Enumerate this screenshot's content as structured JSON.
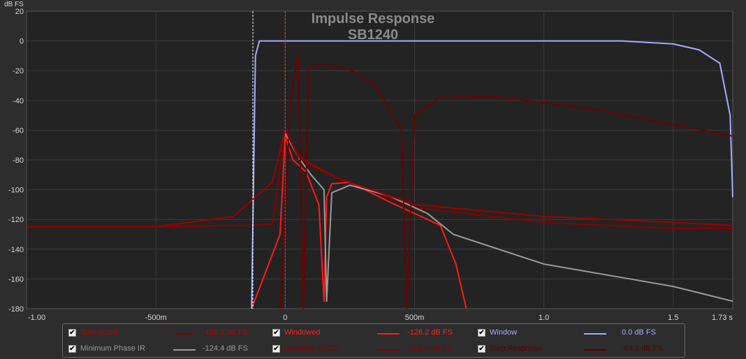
{
  "chart_data": {
    "type": "line",
    "title": "Impulse Response",
    "subtitle": "SB1240",
    "ylabel": "dB FS",
    "xunit": "s",
    "xlim": [
      -1.0,
      1.73
    ],
    "ylim": [
      -180,
      20
    ],
    "grid": true,
    "x_ticks": [
      {
        "value": -1.0,
        "label": "-1.00"
      },
      {
        "value": -0.5,
        "label": "-500m"
      },
      {
        "value": 0.0,
        "label": "0"
      },
      {
        "value": 0.5,
        "label": "500m"
      },
      {
        "value": 1.0,
        "label": "1.0"
      },
      {
        "value": 1.5,
        "label": "1.5"
      },
      {
        "value": 1.73,
        "label": "1.73 s"
      }
    ],
    "y_ticks": [
      20,
      0,
      -20,
      -40,
      -60,
      -80,
      -100,
      -120,
      -140,
      -160,
      -180
    ],
    "markers": [
      {
        "x": -0.125,
        "color": "#ffffff"
      },
      {
        "x": 0.0,
        "color": "#ff3030"
      }
    ],
    "series": [
      {
        "name": "Soundcard",
        "color": "#8b0000",
        "x": [
          -1.0,
          -0.5,
          -0.2,
          -0.13,
          -0.05,
          0.0,
          0.05,
          0.1,
          0.2,
          0.5,
          1.0,
          1.5,
          1.73
        ],
        "y": [
          -125,
          -125,
          -124,
          -124,
          -123,
          -62,
          -76,
          -84,
          -92,
          -112,
          -122,
          -126,
          -126
        ]
      },
      {
        "name": "Windowed",
        "color": "#ff1a1a",
        "x": [
          -0.13,
          -0.02,
          0.0,
          0.03,
          0.08,
          0.13,
          0.15,
          0.16,
          0.18,
          0.25,
          0.4,
          0.6,
          0.66,
          0.7
        ],
        "y": [
          -180,
          -130,
          -64,
          -80,
          -88,
          -110,
          -175,
          -105,
          -96,
          -95,
          -108,
          -124,
          -150,
          -180
        ]
      },
      {
        "name": "Window",
        "color": "#aaaaff",
        "x": [
          -0.13,
          -0.115,
          -0.1,
          0.0,
          1.0,
          1.3,
          1.5,
          1.6,
          1.68,
          1.72,
          1.73
        ],
        "y": [
          -180,
          -10,
          0,
          0,
          0,
          0,
          -2,
          -6,
          -15,
          -50,
          -105
        ]
      },
      {
        "name": "Minimum Phase IR",
        "color": "#9a9a9a",
        "x": [
          0.0,
          0.05,
          0.1,
          0.15,
          0.16,
          0.18,
          0.25,
          0.4,
          0.55,
          0.65,
          1.0,
          1.5,
          1.73
        ],
        "y": [
          -62,
          -78,
          -90,
          -100,
          -175,
          -102,
          -97,
          -104,
          -116,
          -130,
          -150,
          -165,
          -175
        ]
      },
      {
        "name": "Envelope (ETC)",
        "color": "#a00000",
        "x": [
          -1.0,
          -0.5,
          -0.2,
          -0.05,
          0.0,
          0.05,
          0.2,
          0.5,
          1.0,
          1.5,
          1.73
        ],
        "y": [
          -125,
          -125,
          -118,
          -95,
          -60,
          -78,
          -92,
          -110,
          -118,
          -122,
          -124
        ]
      },
      {
        "name": "Step Response",
        "color": "#6e0000",
        "x": [
          -0.02,
          0.0,
          0.02,
          0.05,
          0.07,
          0.09,
          0.15,
          0.25,
          0.35,
          0.45,
          0.47,
          0.5,
          0.6,
          0.8,
          1.2,
          1.73
        ],
        "y": [
          -180,
          -120,
          -40,
          -10,
          -180,
          -18,
          -16,
          -19,
          -30,
          -60,
          -180,
          -50,
          -38,
          -37,
          -46,
          -64
        ]
      }
    ]
  },
  "legend": {
    "items": [
      {
        "label": "Soundcard",
        "value": "-126.2 dB FS",
        "color": "#c00000",
        "swatch": "#8b0000",
        "checked": true
      },
      {
        "label": "Windowed",
        "value": "-126.2 dB FS",
        "color": "#ff2020",
        "swatch": "#ff1a1a",
        "checked": true
      },
      {
        "label": "Window",
        "value": "0.0 dB FS",
        "color": "#aaaaff",
        "swatch": "#aaaaff",
        "checked": true
      },
      {
        "label": "Minimum Phase IR",
        "value": "-124.4 dB FS",
        "color": "#9a9a9a",
        "swatch": "#9a9a9a",
        "checked": true
      },
      {
        "label": "Envelope (ETC)",
        "value": "-113.8 dB FS",
        "color": "#8a0000",
        "swatch": "#8a0000",
        "checked": true
      },
      {
        "label": "Step Response",
        "value": "-63.1 dB FS",
        "color": "#5a0000",
        "swatch": "#5a0000",
        "checked": true
      }
    ],
    "check_glyph": "✔"
  }
}
